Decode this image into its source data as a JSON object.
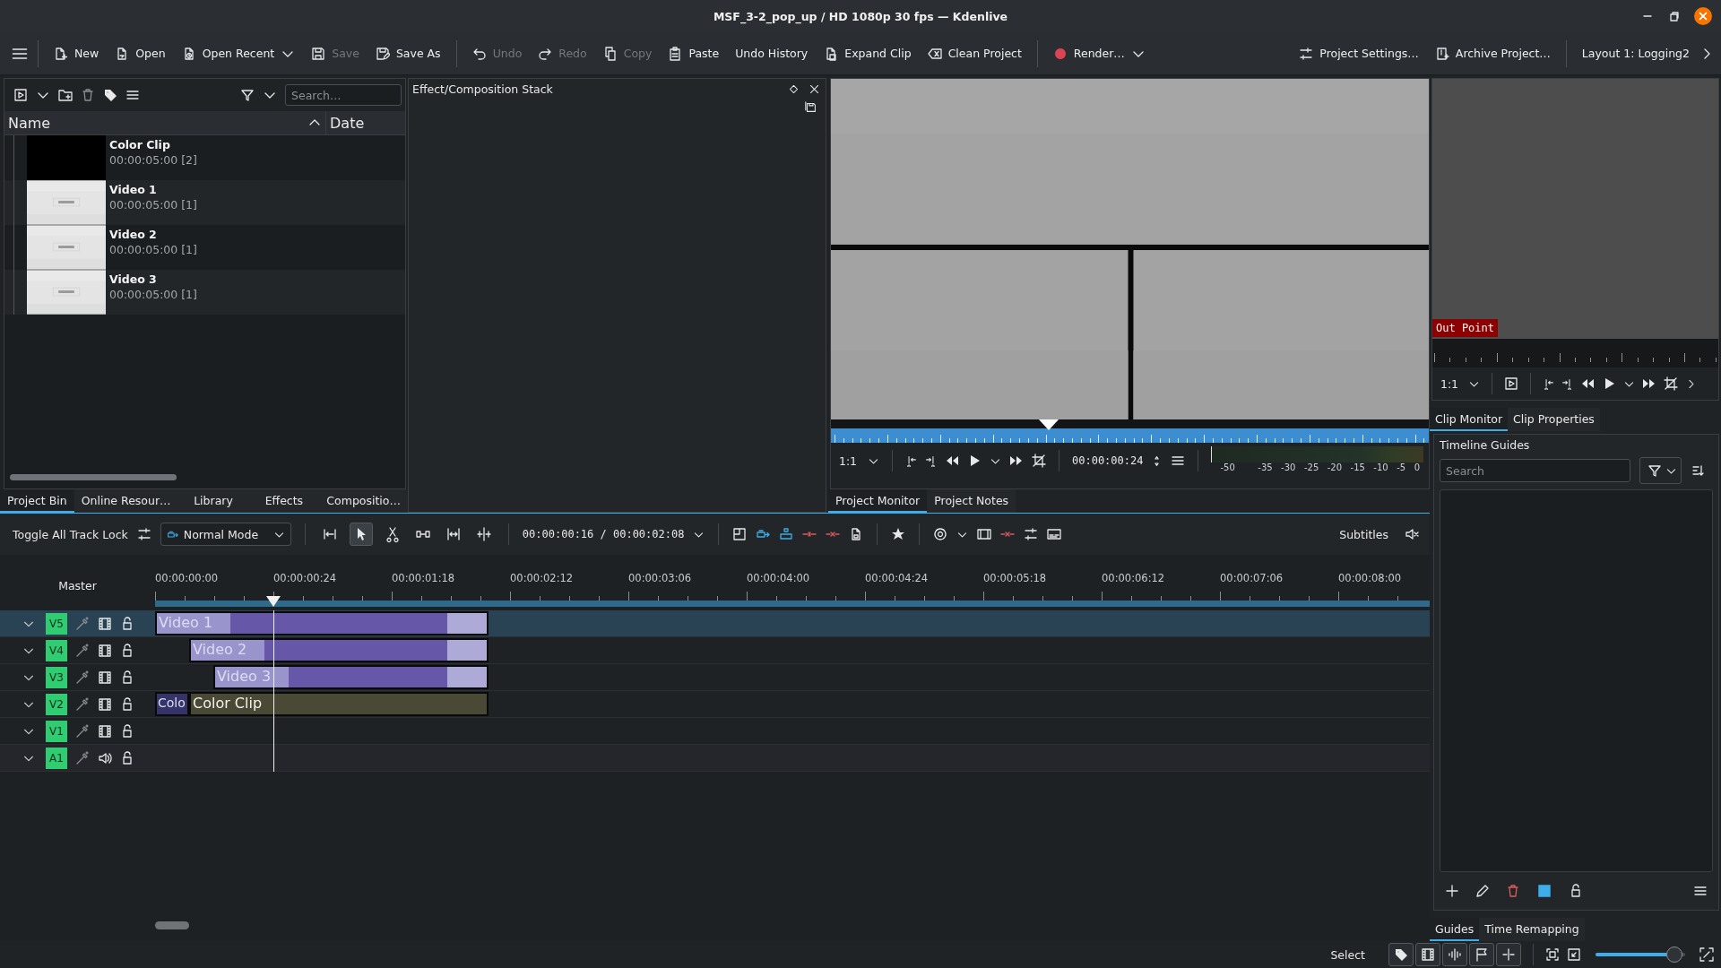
{
  "window": {
    "title": "MSF_3-2_pop_up / HD 1080p 30 fps — Kdenlive"
  },
  "toolbar": {
    "left_groups": [
      [
        {
          "label": "New",
          "disabled": false,
          "dropdown": false
        },
        {
          "label": "Open",
          "disabled": false,
          "dropdown": false
        },
        {
          "label": "Open Recent",
          "disabled": false,
          "dropdown": true
        },
        {
          "label": "Save",
          "disabled": true,
          "dropdown": false
        },
        {
          "label": "Save As",
          "disabled": false,
          "dropdown": false
        }
      ],
      [
        {
          "label": "Undo",
          "disabled": true,
          "dropdown": false
        },
        {
          "label": "Redo",
          "disabled": true,
          "dropdown": false
        },
        {
          "label": "Copy",
          "disabled": true,
          "dropdown": false
        },
        {
          "label": "Paste",
          "disabled": false,
          "dropdown": false
        },
        {
          "label": "Undo History",
          "disabled": false,
          "dropdown": false
        },
        {
          "label": "Expand Clip",
          "disabled": false,
          "dropdown": false
        },
        {
          "label": "Clean Project",
          "disabled": false,
          "dropdown": false
        }
      ],
      [
        {
          "label": "Render…",
          "disabled": false,
          "dropdown": true
        }
      ]
    ],
    "right_groups": [
      [
        {
          "label": "Project Settings…",
          "disabled": false,
          "dropdown": false
        },
        {
          "label": "Archive Project…",
          "disabled": false,
          "dropdown": false
        }
      ],
      [
        {
          "label": "Layout 1: Logging2",
          "disabled": false,
          "dropdown": false
        }
      ]
    ]
  },
  "project_bin": {
    "search": {
      "placeholder": "Search…"
    },
    "columns": [
      {
        "label": "Name",
        "sorted": true
      },
      {
        "label": "Date",
        "sorted": false
      }
    ],
    "clips": [
      {
        "name": "Color Clip",
        "duration": "00:00:05:00 [2]",
        "kind": "color"
      },
      {
        "name": "Video 1",
        "duration": "00:00:05:00 [1]",
        "kind": "video"
      },
      {
        "name": "Video 2",
        "duration": "00:00:05:00 [1]",
        "kind": "video"
      },
      {
        "name": "Video 3",
        "duration": "00:00:05:00 [1]",
        "kind": "video"
      }
    ],
    "tabs": [
      {
        "label": "Project Bin",
        "selected": true
      },
      {
        "label": "Online Resour…",
        "selected": false
      },
      {
        "label": "Library",
        "selected": false
      },
      {
        "label": "Effects",
        "selected": false
      },
      {
        "label": "Compositio…",
        "selected": false
      }
    ]
  },
  "effect_stack": {
    "title": "Effect/Composition Stack"
  },
  "project_monitor": {
    "zoom": "1:1",
    "timecode": "00:00:00:24",
    "meter_labels": [
      "-50",
      "-35",
      "-30",
      "-25",
      "-20",
      "-15",
      "-10",
      "-5",
      "0"
    ],
    "tabs": [
      {
        "label": "Project Monitor",
        "selected": true
      },
      {
        "label": "Project Notes",
        "selected": false
      }
    ]
  },
  "clip_monitor": {
    "marker": "Out Point",
    "zoom": "1:1",
    "tabs": [
      {
        "label": "Clip Monitor",
        "selected": true
      },
      {
        "label": "Clip Properties",
        "selected": false
      }
    ]
  },
  "guides": {
    "title": "Timeline Guides",
    "search": {
      "placeholder": "Search"
    },
    "tabs": [
      {
        "label": "Guides",
        "selected": true
      },
      {
        "label": "Time Remapping",
        "selected": false
      }
    ]
  },
  "timeline": {
    "lock_button": "Toggle All Track Lock",
    "mode": "Normal Mode",
    "tools": [
      {
        "selected": false
      },
      {
        "selected": true
      },
      {
        "selected": false
      },
      {
        "selected": false
      },
      {
        "selected": false
      },
      {
        "selected": false
      }
    ],
    "timecode": "00:00:00:16 / 00:00:02:08",
    "subtitles": "Subtitles",
    "master": "Master",
    "ruler": [
      "00:00:00:00",
      "00:00:00:24",
      "00:00:01:18",
      "00:00:02:12",
      "00:00:03:06",
      "00:00:04:00",
      "00:00:04:24",
      "00:00:05:18",
      "00:00:06:12",
      "00:00:07:06",
      "00:00:08:00"
    ],
    "tracks": [
      {
        "name": "V5",
        "kind": "video",
        "selected": true,
        "clips": [
          {
            "label": "Video 1",
            "kind": "video"
          }
        ]
      },
      {
        "name": "V4",
        "kind": "video",
        "selected": false,
        "clips": [
          {
            "label": "Video 2",
            "kind": "video"
          }
        ]
      },
      {
        "name": "V3",
        "kind": "video",
        "selected": false,
        "clips": [
          {
            "label": "Video 3",
            "kind": "video"
          }
        ]
      },
      {
        "name": "V2",
        "kind": "video",
        "selected": false,
        "clips": [
          {
            "label": "Colo",
            "kind": "composition"
          },
          {
            "label": "Color Clip",
            "kind": "color"
          }
        ]
      },
      {
        "name": "V1",
        "kind": "video",
        "selected": false
      },
      {
        "name": "A1",
        "kind": "audio",
        "selected": false
      }
    ]
  },
  "status": {
    "mode": "Select",
    "zoom": {
      "level": 0.88
    }
  }
}
